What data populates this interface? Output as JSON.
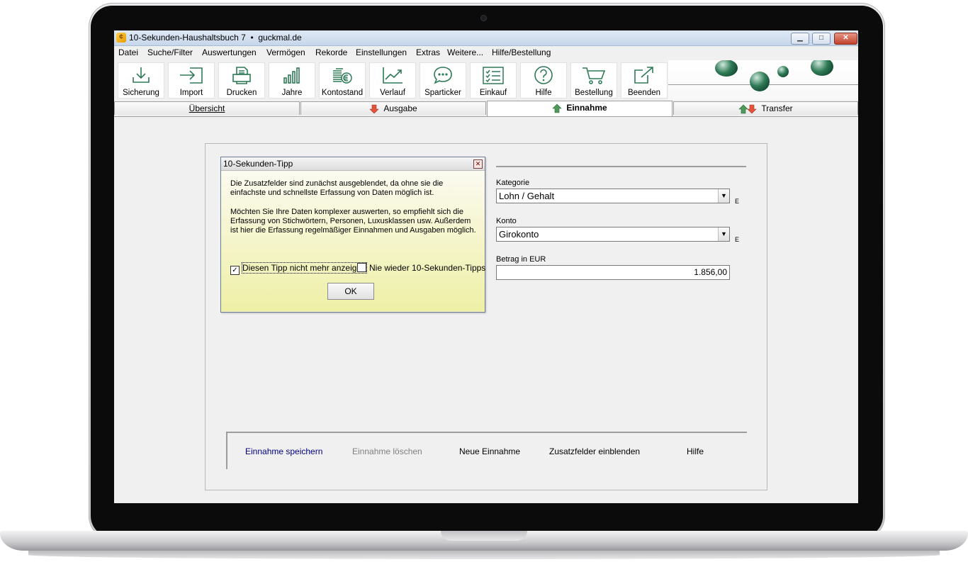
{
  "window": {
    "title": "10-Sekunden-Haushaltsbuch 7",
    "separator": "•",
    "site": "guckmal.de",
    "minimize_glyph": "▁",
    "maximize_glyph": "□",
    "close_glyph": "✕"
  },
  "menu": [
    "Datei",
    "Suche/Filter",
    "Auswertungen",
    "Vermögen",
    "Rekorde",
    "Einstellungen",
    "Extras",
    "Weitere...",
    "Hilfe/Bestellung"
  ],
  "toolbar": [
    {
      "label": "Sicherung",
      "icon": "download-tray-icon"
    },
    {
      "label": "Import",
      "icon": "import-arrow-icon"
    },
    {
      "label": "Drucken",
      "icon": "printer-icon"
    },
    {
      "label": "Jahre",
      "icon": "bar-chart-icon"
    },
    {
      "label": "Kontostand",
      "icon": "coins-euro-icon"
    },
    {
      "label": "Verlauf",
      "icon": "trend-line-icon"
    },
    {
      "label": "Sparticker",
      "icon": "speech-bubble-icon"
    },
    {
      "label": "Einkauf",
      "icon": "checklist-icon"
    },
    {
      "label": "Hilfe",
      "icon": "help-circle-icon"
    },
    {
      "label": "Bestellung",
      "icon": "cart-icon"
    },
    {
      "label": "Beenden",
      "icon": "exit-icon"
    }
  ],
  "tabs": [
    {
      "label": "Übersicht",
      "active": false
    },
    {
      "label": "Ausgabe",
      "active": false,
      "icon": "down-arrow-red-icon"
    },
    {
      "label": "Einnahme",
      "active": true,
      "icon": "up-arrow-green-icon"
    },
    {
      "label": "Transfer",
      "active": false,
      "icon": "up-down-arrows-icon"
    }
  ],
  "form": {
    "kategorie_label": "Kategorie",
    "kategorie_value": "Lohn / Gehalt",
    "konto_label": "Konto",
    "konto_value": "Girokonto",
    "betrag_label": "Betrag in EUR",
    "betrag_value": "1.856,00",
    "e_marker": "E",
    "dropdown_glyph": "▼"
  },
  "actions": {
    "save": "Einnahme speichern",
    "delete": "Einnahme löschen",
    "new": "Neue Einnahme",
    "extra_fields": "Zusatzfelder einblenden",
    "help": "Hilfe"
  },
  "dialog": {
    "title": "10-Sekunden-Tipp",
    "close_glyph": "✕",
    "para1": "Die Zusatzfelder sind zunächst ausgeblendet, da ohne sie die einfachste und schnellste Erfassung von Daten möglich ist.",
    "para2": "Möchten Sie Ihre Daten komplexer auswerten, so empfiehlt sich die Erfassung von Stichwörtern, Personen, Luxusklassen usw. Außerdem ist hier die Erfassung regelmäßiger Einnahmen und Ausgaben möglich.",
    "check1_label": "Diesen Tipp nicht mehr anzeigen",
    "check1_checked": true,
    "check1_glyph": "✓",
    "check2_label": "Nie wieder 10-Sekunden-Tipps",
    "check2_checked": false,
    "ok": "OK"
  },
  "colors": {
    "accent_green": "#2f7a57",
    "arrow_red": "#e2533c",
    "arrow_green": "#4e9a5a",
    "save_text": "#000080",
    "disabled_text": "#808080"
  }
}
